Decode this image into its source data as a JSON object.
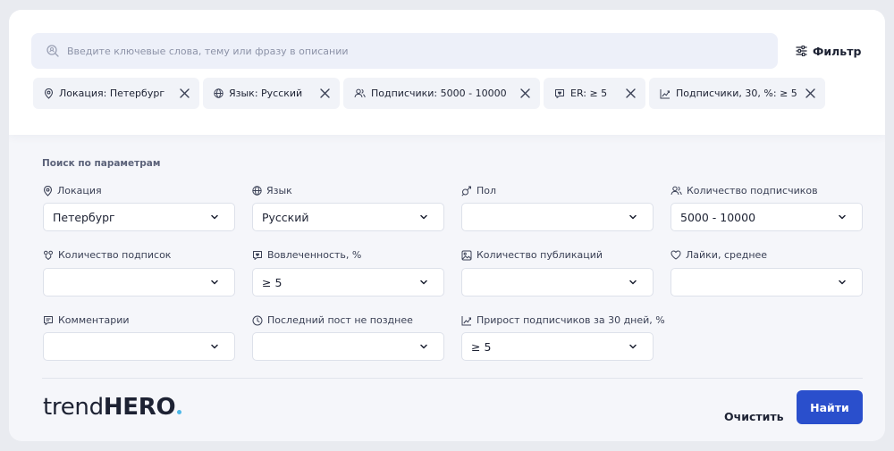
{
  "search": {
    "placeholder": "Введите ключевые слова, тему или фразу в описании",
    "value": ""
  },
  "filter_button": {
    "label": "Фильтр",
    "icon": "sliders-icon"
  },
  "chips": [
    {
      "label": "Локация: Петербург",
      "icon": "location-pin-icon"
    },
    {
      "label": "Язык: Русский",
      "icon": "globe-icon"
    },
    {
      "label": "Подписчики: 5000 - 10000",
      "icon": "users-icon"
    },
    {
      "label": "ER: ≥ 5",
      "icon": "chat-heart-icon"
    },
    {
      "label": "Подписчики, 30, %: ≥ 5",
      "icon": "growth-chart-icon"
    }
  ],
  "params": {
    "title": "Поиск по параметрам",
    "fields": [
      {
        "label": "Локация",
        "value": "Петербург",
        "icon": "location-pin-icon"
      },
      {
        "label": "Язык",
        "value": "Русский",
        "icon": "globe-icon"
      },
      {
        "label": "Пол",
        "value": "",
        "icon": "gender-icon"
      },
      {
        "label": "Количество подписчиков",
        "value": "5000 - 10000",
        "icon": "users-icon"
      },
      {
        "label": "Количество подписок",
        "value": "",
        "icon": "user-follow-icon"
      },
      {
        "label": "Вовлеченность, %",
        "value": "≥ 5",
        "icon": "chat-heart-icon"
      },
      {
        "label": "Количество публикаций",
        "value": "",
        "icon": "image-icon"
      },
      {
        "label": "Лайки, среднее",
        "value": "",
        "icon": "heart-icon"
      },
      {
        "label": "Комментарии",
        "value": "",
        "icon": "comment-icon"
      },
      {
        "label": "Последний пост не позднее",
        "value": "",
        "icon": "clock-icon"
      },
      {
        "label": "Прирост подписчиков за 30 дней, %",
        "value": "≥ 5",
        "icon": "growth-chart-icon"
      }
    ]
  },
  "footer": {
    "logo_light": "trend",
    "logo_bold": "HERO",
    "clear_label": "Очистить",
    "find_label": "Найти"
  },
  "colors": {
    "accent": "#2a4fcc",
    "logo_dot": "#4db8e8",
    "background": "#f5f6fa"
  }
}
